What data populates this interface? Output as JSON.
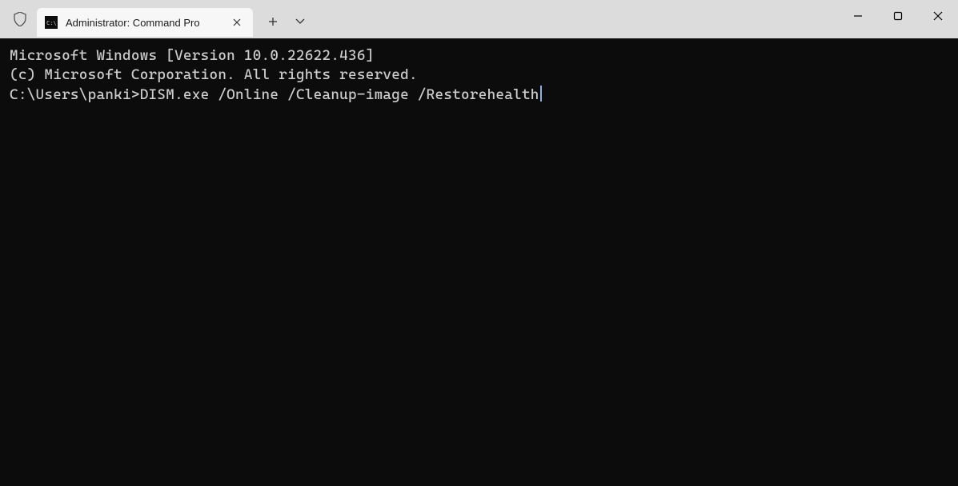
{
  "tab": {
    "title": "Administrator: Command Pro",
    "icon_name": "cmd-icon"
  },
  "terminal": {
    "line1": "Microsoft Windows [Version 10.0.22622.436]",
    "line2": "(c) Microsoft Corporation. All rights reserved.",
    "blank": "",
    "prompt": "C:\\Users\\panki>",
    "command": "DISM.exe /Online /Cleanup-image /Restorehealth"
  }
}
